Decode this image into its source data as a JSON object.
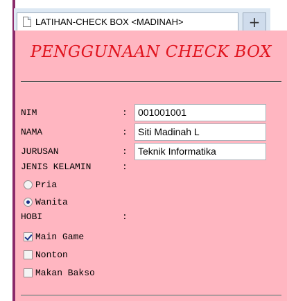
{
  "tab": {
    "title": "LATIHAN-CHECK BOX <MADINAH>",
    "new_tab_label": "+"
  },
  "page": {
    "heading": "PENGGUNAAN CHECK BOX",
    "colors": {
      "background": "#ffb6c1",
      "heading": "#e0141e",
      "tab_bar": "#dde8f3"
    },
    "form": {
      "colon": ":",
      "nim": {
        "label": "NIM",
        "value": "001001001"
      },
      "nama": {
        "label": "NAMA",
        "value": "Siti Madinah L"
      },
      "jurusan": {
        "label": "JURUSAN",
        "value": "Teknik Informatika"
      },
      "jenis_kelamin": {
        "label": "JENIS KELAMIN",
        "options": [
          {
            "label": "Pria",
            "checked": false
          },
          {
            "label": "Wanita",
            "checked": true
          }
        ]
      },
      "hobi": {
        "label": "HOBI",
        "options": [
          {
            "label": "Main Game",
            "checked": true
          },
          {
            "label": "Nonton",
            "checked": false
          },
          {
            "label": "Makan Bakso",
            "checked": false
          }
        ]
      }
    }
  }
}
